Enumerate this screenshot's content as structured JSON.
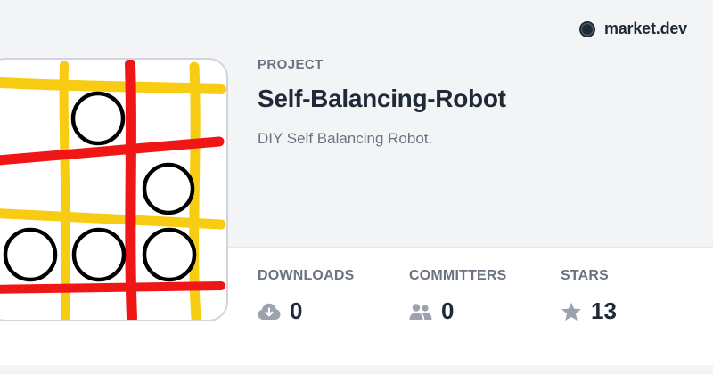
{
  "brand": {
    "name": "market.dev",
    "logo_icon": "circle-logo-icon"
  },
  "project": {
    "kind_label": "PROJECT",
    "title": "Self-Balancing-Robot",
    "description": "DIY Self Balancing Robot.",
    "thumbnail": {
      "image": "tic-tac-toe-grid-image",
      "colors": {
        "red": "#f01616",
        "yellow": "#f7cc12"
      }
    }
  },
  "stats": {
    "downloads": {
      "label": "DOWNLOADS",
      "value": "0",
      "icon": "cloud-download-icon"
    },
    "committers": {
      "label": "COMMITTERS",
      "value": "0",
      "icon": "users-icon"
    },
    "stars": {
      "label": "STARS",
      "value": "13",
      "icon": "star-icon"
    }
  },
  "colors": {
    "background": "#ffffff",
    "band": "#f3f4f6",
    "text_primary": "#1f2937",
    "text_muted": "#6b7280",
    "icon_muted": "#9ca3af"
  }
}
